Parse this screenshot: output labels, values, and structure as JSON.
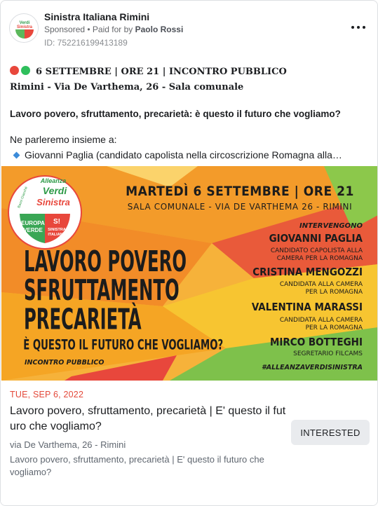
{
  "header": {
    "page_name": "Sinistra Italiana Rimini",
    "sponsored_label": "Sponsored",
    "paid_by_prefix": " • Paid for by ",
    "paid_by_name": "Paolo Rossi",
    "ad_id": "ID: 752216199413189"
  },
  "post": {
    "line1": "6 SETTEMBRE | ORE 21 | INCONTRO PUBBLICO",
    "line2": "Rimini - Via De Varthema, 26 - Sala comunale",
    "line3": "Lavoro povero, sfruttamento, precarietà: è questo il futuro che vogliamo?",
    "line4": "Ne parleremo insieme a:",
    "line5": "Giovanni Paglia (candidato capolista nella circoscrizione Romagna alla…"
  },
  "banner": {
    "logo_alleanza": "Alleanza",
    "logo_verdi": "Verdi",
    "logo_sinistra": "Sinistra",
    "logo_europa": "EUROPA",
    "logo_verde": "VERDE",
    "logo_si_mark": "S!",
    "logo_si_1": "SINISTRA",
    "logo_si_2": "ITALIANA",
    "logo_side": "Bassi Giacché",
    "date_line": "MARTEDÌ 6 SETTEMBRE | ORE 21",
    "venue_line": "SALA COMUNALE - VIA DE VARTHEMA 26 - RIMINI",
    "headline_1": "LAVORO POVERO",
    "headline_2": "SFRUTTAMENTO",
    "headline_3": "PRECARIETÀ",
    "headline_4": "È QUESTO IL FUTURO CHE VOGLIAMO?",
    "incontro": "INCONTRO PUBBLICO",
    "intervengono": "INTERVENGONO",
    "speaker1_name": "GIOVANNI PAGLIA",
    "speaker1_role_1": "CANDIDATO CAPOLISTA ALLA",
    "speaker1_role_2": "CAMERA PER LA ROMAGNA",
    "speaker2_name": "CRISTINA MENGOZZI",
    "speaker2_role_1": "CANDIDATA ALLA CAMERA",
    "speaker2_role_2": "PER LA ROMAGNA",
    "speaker3_name": "VALENTINA MARASSI",
    "speaker3_role_1": "CANDIDATA ALLA CAMERA",
    "speaker3_role_2": "PER LA ROMAGNA",
    "speaker4_name": "MIRCO BOTTEGHI",
    "speaker4_role_1": "SEGRETARIO FILCAMS",
    "hashtag": "#ALLEANZAVERDISINISTRA"
  },
  "event": {
    "date": "TUE, SEP 6, 2022",
    "title": "Lavoro povero, sfruttamento, precarietà | E' questo il futuro che vogliamo?",
    "location": "via De Varthema, 26 - Rimini",
    "description": "Lavoro povero, sfruttamento, precarietà | E' questo il futuro che vogliamo?",
    "interested_label": "INTERESTED"
  },
  "colors": {
    "red_dot": "#e8473c",
    "green_dot": "#2fbf5c",
    "event_date": "#e4493a",
    "banner_orange": "#f28c28",
    "banner_red": "#e8473c",
    "banner_yellow": "#f7c531",
    "banner_green": "#7ec14b"
  },
  "icons": {
    "menu": "more-horizontal-icon",
    "bullet": "small-blue-diamond-icon"
  }
}
